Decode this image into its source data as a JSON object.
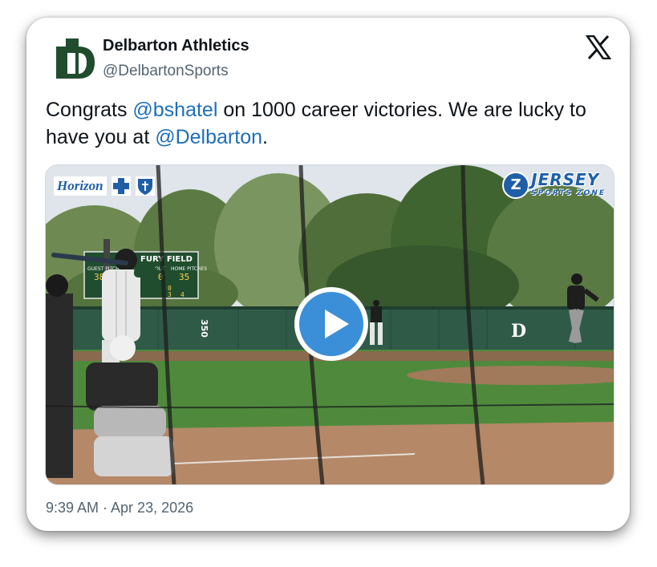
{
  "tweet": {
    "author_name": "Delbarton Athletics",
    "author_handle": "@DelbartonSports",
    "text_parts": [
      {
        "text": "Congrats ",
        "type": "text"
      },
      {
        "text": "@bshatel",
        "type": "mention"
      },
      {
        "text": " on 1000 career victories. We are lucky to have you at ",
        "type": "text"
      },
      {
        "text": "@Delbarton",
        "type": "mention"
      },
      {
        "text": ".",
        "type": "text"
      }
    ],
    "timestamp": "9:39 AM · Apr 23, 2026",
    "platform_icon": "x-logo-icon",
    "avatar_icon": "delbarton-d-logo-icon"
  },
  "video": {
    "sponsor_left": "Horizon",
    "sponsor_right_main": "JERSEY",
    "sponsor_right_sub": "SPORTS ZONE",
    "play_icon": "play-icon",
    "scoreboard": {
      "title": "FURY FIELD",
      "labels": [
        "GUEST PITCHES",
        "OUT",
        "HOME PITCHES"
      ],
      "values": [
        "38",
        "0",
        "35"
      ],
      "bottom_values": [
        "0",
        "3",
        "4"
      ]
    },
    "fence_marker": "350"
  },
  "colors": {
    "mention": "#1d6fb8",
    "play_button": "#3b8fd8",
    "brand_green": "#1f4d2e",
    "text_primary": "#0f1419",
    "text_secondary": "#536471"
  }
}
